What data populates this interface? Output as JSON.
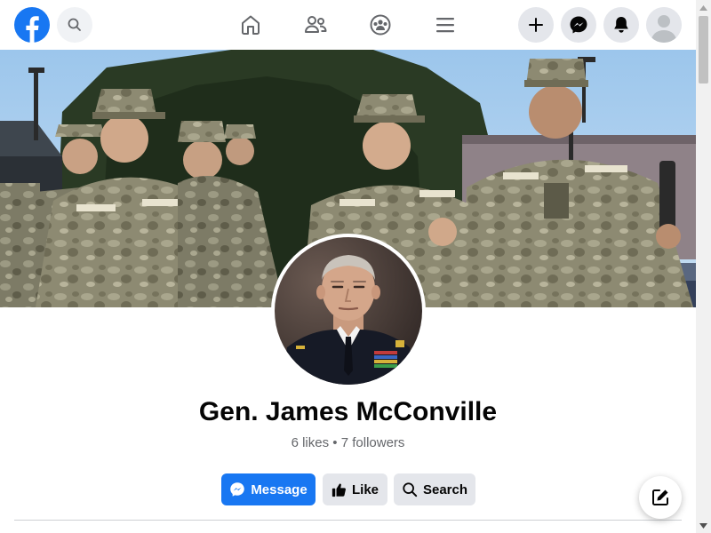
{
  "app": {
    "brand_color": "#1877f2"
  },
  "top_nav": {
    "icons": [
      "facebook-logo-icon",
      "search-icon",
      "home-icon",
      "friends-icon",
      "groups-icon",
      "menu-icon",
      "plus-icon",
      "messenger-icon",
      "notifications-icon",
      "profile-avatar-icon"
    ]
  },
  "page": {
    "name": "Gen. James McConville",
    "likes": "6 likes",
    "separator": "•",
    "followers": "7 followers"
  },
  "actions": {
    "message_label": "Message",
    "like_label": "Like",
    "search_label": "Search"
  },
  "colors": {
    "primary": "#1877f2",
    "secondary_btn": "#e4e6eb",
    "text": "#050505",
    "muted": "#65676b"
  }
}
